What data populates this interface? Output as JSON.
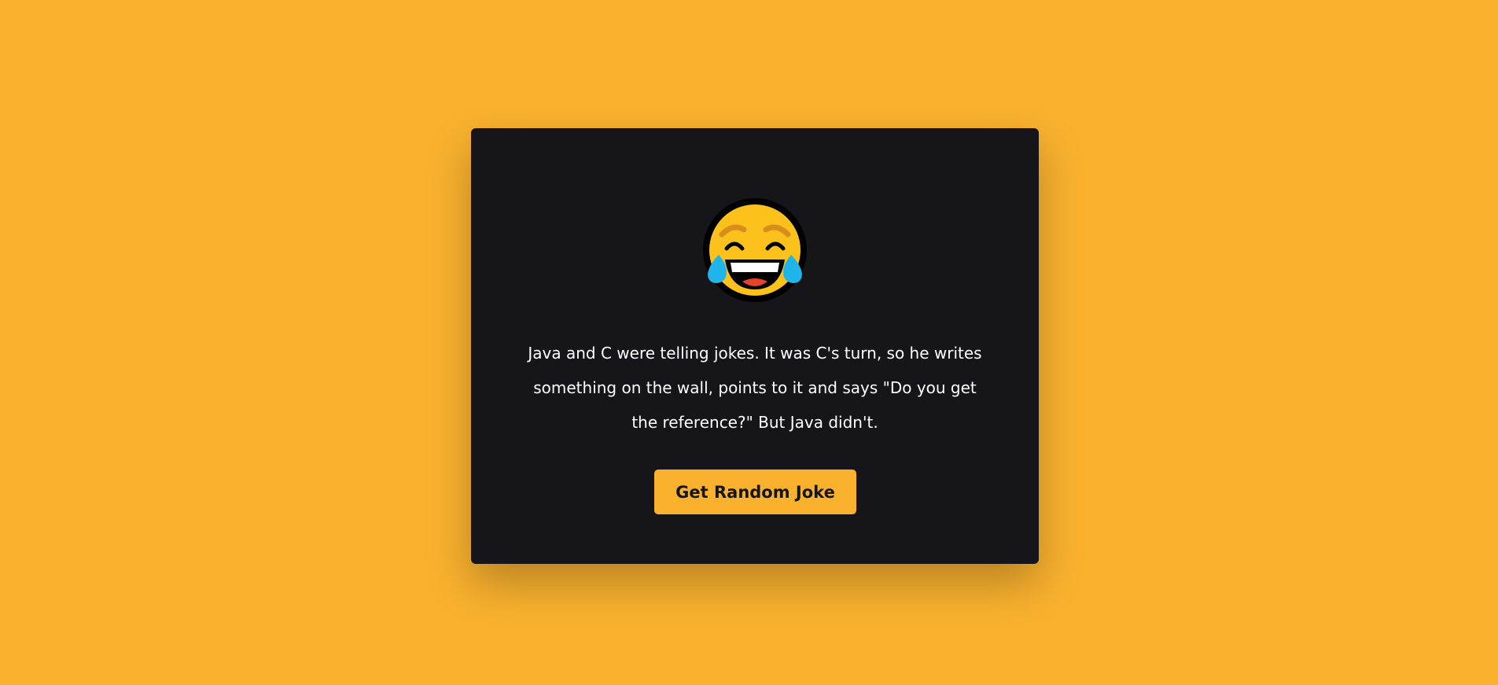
{
  "colors": {
    "background": "#F9B12E",
    "card": "#16161A",
    "button": "#F9B12E",
    "button_text": "#16161A",
    "joke_text": "#FFFFFF"
  },
  "emoji": {
    "icon": "face-with-tears-of-joy-icon"
  },
  "joke": {
    "text": "Java and C were telling jokes. It was C's turn, so he writes something on the wall, points to it and says \"Do you get the reference?\" But Java didn't."
  },
  "button": {
    "label": "Get Random Joke"
  }
}
